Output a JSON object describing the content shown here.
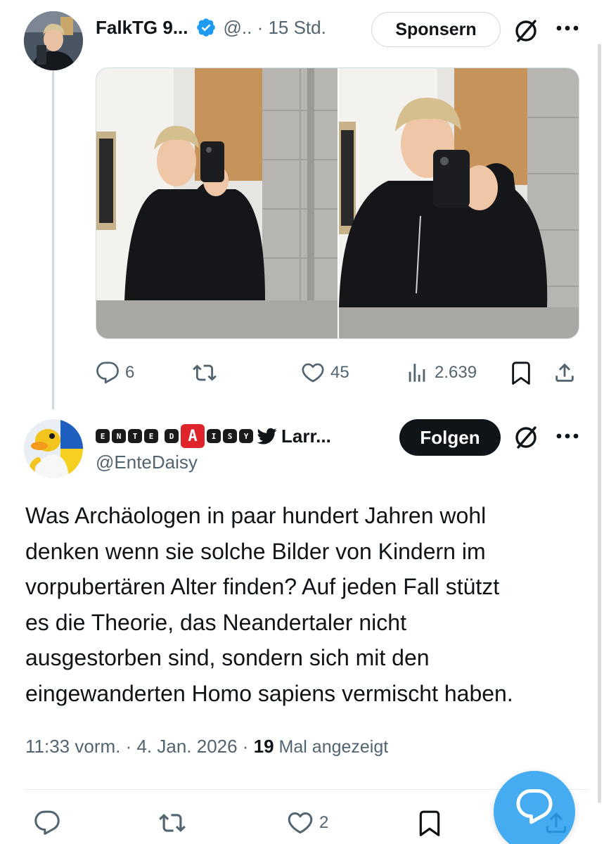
{
  "parent_post": {
    "author_name": "FalkTG 9...",
    "meta": "@.. · 15 Std.",
    "sponsor_label": "Sponsern",
    "metrics": {
      "replies": "6",
      "likes": "45",
      "views": "2.639"
    }
  },
  "main_post": {
    "name_decoration": [
      "E",
      "N",
      "T",
      "E",
      "D",
      "A",
      "I",
      "S",
      "Y"
    ],
    "author_name": "Larr...",
    "handle": "@EnteDaisy",
    "follow_label": "Folgen",
    "body_lines": [
      "Was Archäologen in paar hundert Jahren wohl",
      "denken wenn sie solche Bilder von Kindern im",
      "vorpubertären Alter finden? Auf jeden Fall stützt",
      "es die Theorie, das Neandertaler nicht",
      "ausgestorben sind, sondern sich mit den",
      "eingewanderten Homo sapiens vermischt haben."
    ],
    "timestamp": "11:33 vorm. · 4. Jan. 2026 · ",
    "view_count": "19",
    "view_label": " Mal angezeigt",
    "metrics": {
      "likes": "2"
    }
  },
  "colors": {
    "accent": "#1d9bf0",
    "text": "#0f1419",
    "muted": "#536471",
    "border": "#cfd9de"
  },
  "icons": [
    "reply-icon",
    "repost-icon",
    "like-icon",
    "views-icon",
    "bookmark-icon",
    "share-icon",
    "grok-icon",
    "more-icon",
    "verified-icon",
    "compose-reply-icon"
  ]
}
